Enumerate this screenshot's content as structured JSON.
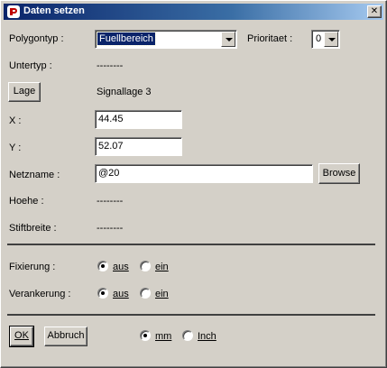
{
  "window": {
    "title": "Daten setzen",
    "close_glyph": "✕",
    "icon": "app-icon"
  },
  "polygontyp": {
    "label": "Polygontyp :",
    "value": "Fuellbereich"
  },
  "prioritaet": {
    "label": "Prioritaet :",
    "value": "0"
  },
  "untertyp": {
    "label": "Untertyp :",
    "value": "--------"
  },
  "lage": {
    "button": "Lage",
    "value": "Signallage 3"
  },
  "x": {
    "label": "X :",
    "value": "44.45"
  },
  "y": {
    "label": "Y :",
    "value": "52.07"
  },
  "netzname": {
    "label": "Netzname :",
    "value": "@20",
    "browse": "Browse"
  },
  "hoehe": {
    "label": "Hoehe :",
    "value": "--------"
  },
  "stiftbreite": {
    "label": "Stiftbreite :",
    "value": "--------"
  },
  "fixierung": {
    "label": "Fixierung :",
    "options": [
      "aus",
      "ein"
    ],
    "selected": "aus"
  },
  "verankerung": {
    "label": "Verankerung :",
    "options": [
      "aus",
      "ein"
    ],
    "selected": "aus"
  },
  "footer": {
    "ok": "OK",
    "abbruch": "Abbruch",
    "units": [
      "mm",
      "Inch"
    ],
    "selected_unit": "mm"
  }
}
